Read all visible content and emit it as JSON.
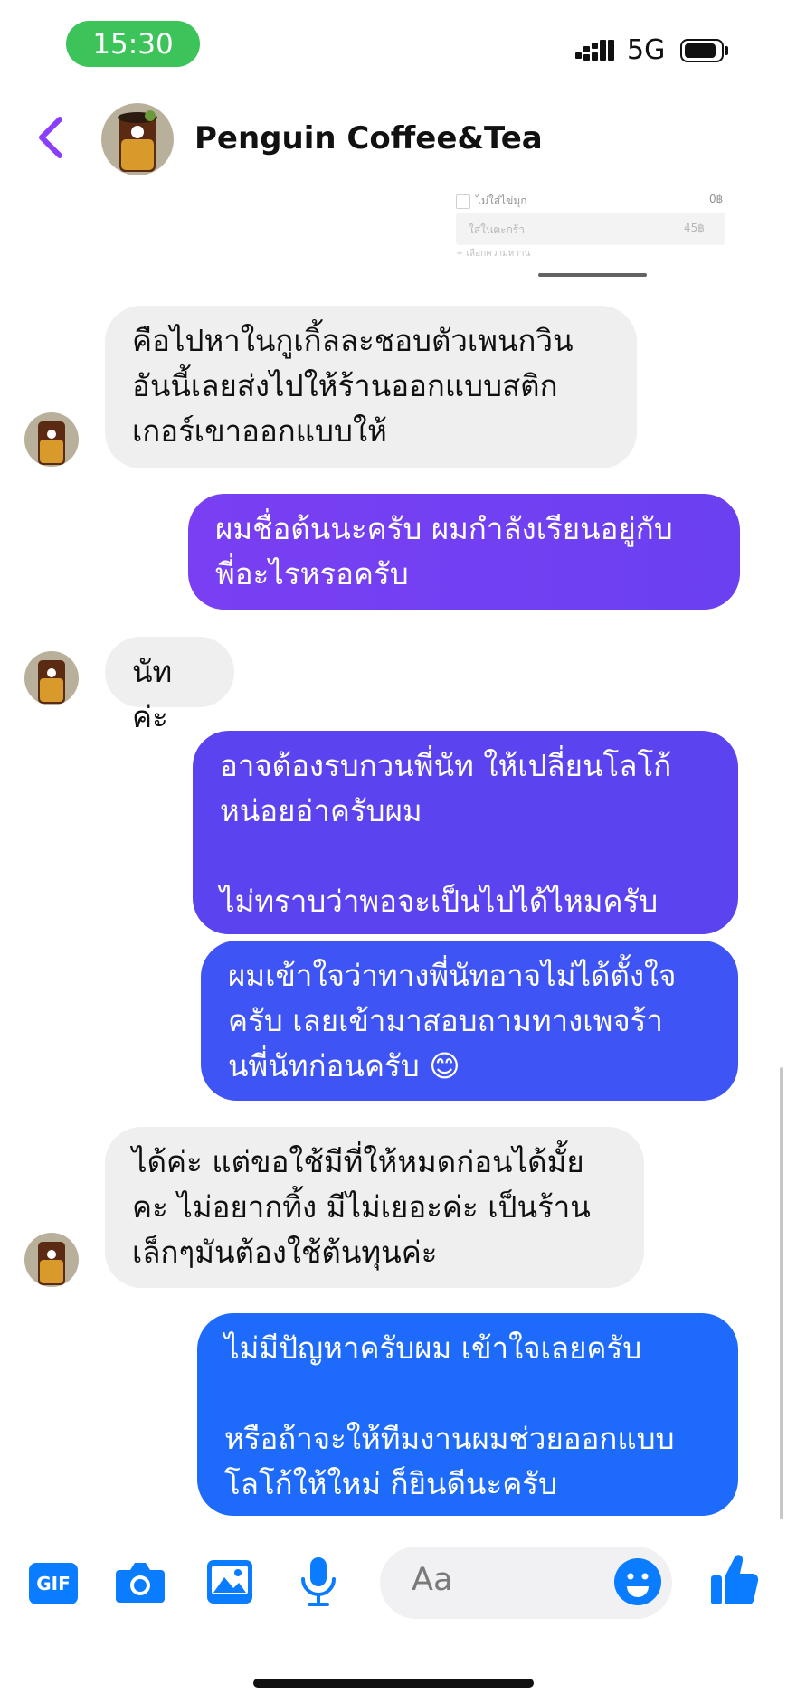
{
  "status": {
    "time": "15:30",
    "network": "5G"
  },
  "header": {
    "title": "Penguin Coffee&Tea"
  },
  "preview": {
    "row1_label": "ไม่ใส่ไข่มุก",
    "row1_value": "0฿",
    "row2_label": "ใส่ในตะกร้า",
    "row2_value": "45฿",
    "row3_label": "+ เลือกความหวาน"
  },
  "messages": [
    {
      "from": "them",
      "text": "คือไปหาในกูเกิ้ลละชอบตัวเพนกวิน\nอันนี้เลยส่งไปให้ร้านออกแบบสติก\nเกอร์เขาออกแบบให้"
    },
    {
      "from": "me",
      "text": "ผมชื่อต้นนะครับ ผมกำลังเรียนอยู่กับ\nพี่อะไรหรอครับ"
    },
    {
      "from": "them",
      "text": "นัทค่ะ"
    },
    {
      "from": "me",
      "text": "อาจต้องรบกวนพี่นัท ให้เปลี่ยนโลโก้\nหน่อยอ่าครับผม\n\nไม่ทราบว่าพอจะเป็นไปได้ไหมครับ"
    },
    {
      "from": "me",
      "text": "ผมเข้าใจว่าทางพี่นัทอาจไม่ได้ตั้งใจ\nครับ เลยเข้ามาสอบถามทางเพจร้า\nนพี่นัทก่อนครับ 😊"
    },
    {
      "from": "them",
      "text": "ได้ค่ะ แต่ขอใช้มีที่ให้หมดก่อนได้มั้ย\nคะ ไม่อยากทิ้ง มีไม่เยอะค่ะ เป็นร้าน\nเล็กๆมันต้องใช้ต้นทุนค่ะ"
    },
    {
      "from": "me",
      "text": "ไม่มีปัญหาครับผม เข้าใจเลยครับ\n\nหรือถ้าจะให้ทีมงานผมช่วยออกแบบ\nโลโก้ให้ใหม่ ก็ยินดีนะครับ"
    }
  ],
  "composer": {
    "gif_label": "GIF",
    "placeholder": "Aa"
  },
  "colors": {
    "accent": "#0a7cff",
    "back_arrow": "#8a3ffc",
    "status_pill": "#3cc35a",
    "bubble_in": "#efefef",
    "bubble_out_gradient": [
      "#7a3ff2",
      "#5b43f0",
      "#3f54f4",
      "#1e6bfb"
    ]
  }
}
